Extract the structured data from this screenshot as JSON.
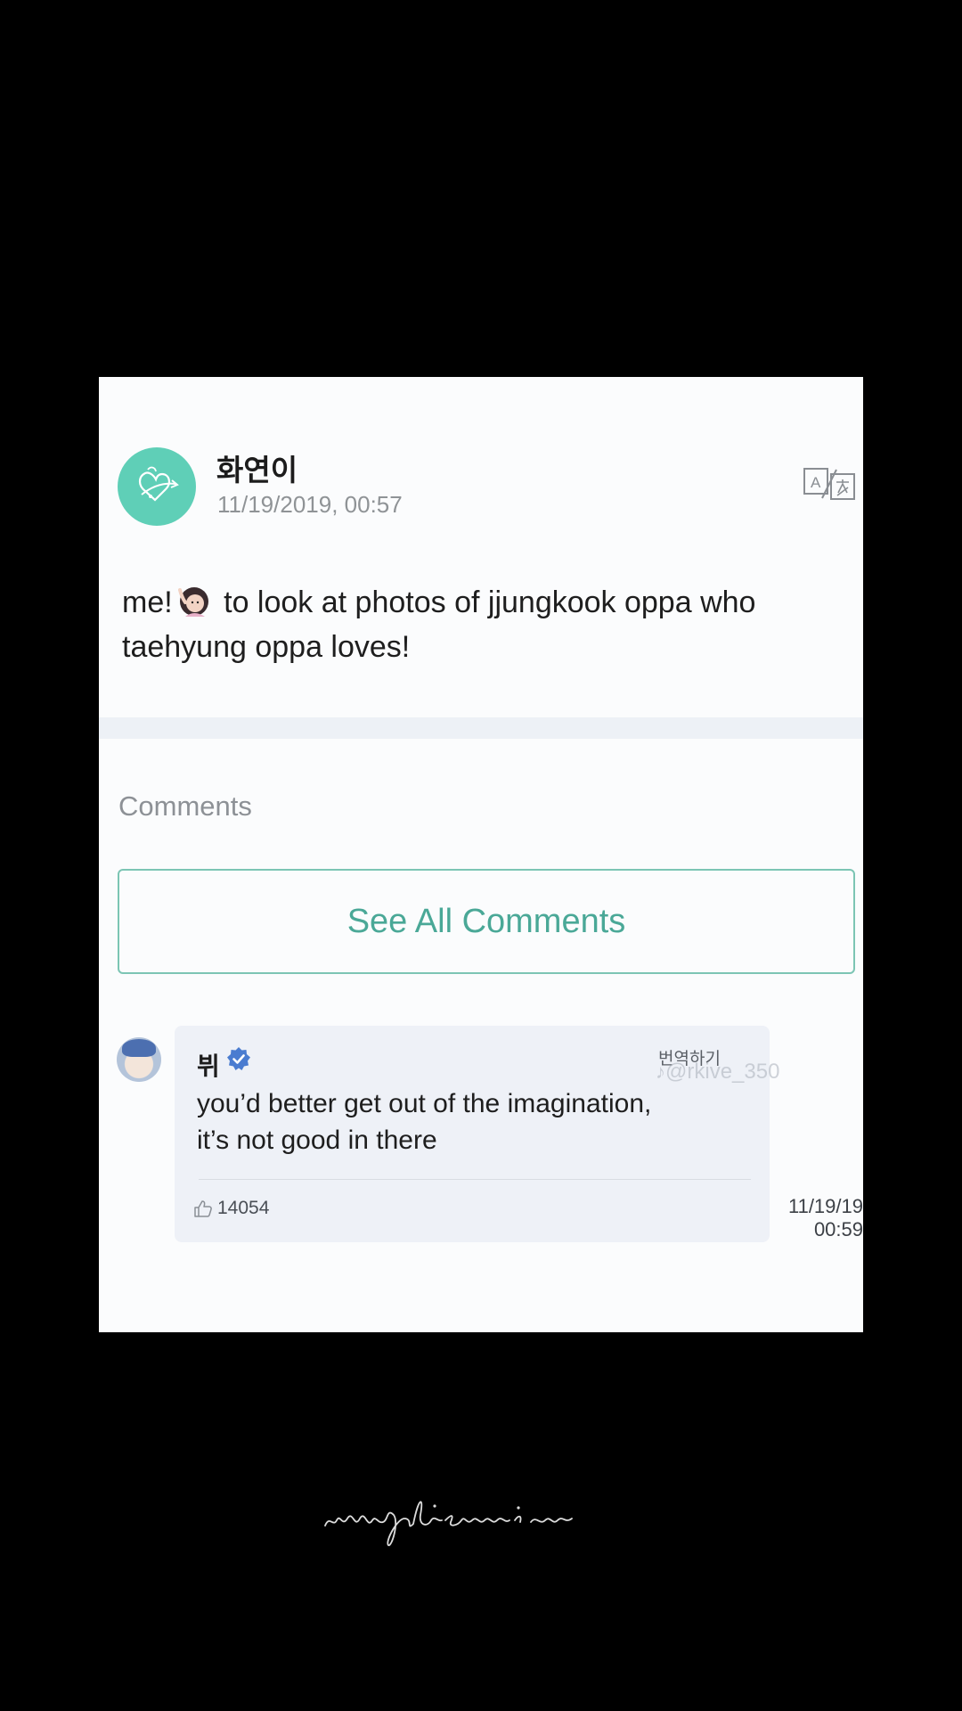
{
  "post": {
    "author": "화연이",
    "timestamp": "11/19/2019, 00:57",
    "text_before_emoji": "me!",
    "text_after_emoji": " to look at photos of jjungkook oppa who taehyung oppa loves!",
    "emoji": "person-raising-hand-emoji",
    "translate_icon": "translate-icon"
  },
  "comments_section": {
    "heading": "Comments",
    "see_all_label": "See All Comments"
  },
  "comment": {
    "author": "뷔",
    "verified_icon": "verified-badge-icon",
    "translate_label": "번역하기",
    "text_line1": "you’d better get out of the imagination,",
    "text_line2": "it’s not good in there",
    "likes": "14054",
    "time_line1": "11/19/19",
    "time_line2": "00:59"
  },
  "watermarks": {
    "tiktok_handle": "@rkive_350"
  },
  "colors": {
    "accent": "#4aa897",
    "avatar_bg": "#5fcfb7",
    "verified": "#4a7cd0",
    "background": "#000000",
    "card": "#fbfcfd"
  }
}
